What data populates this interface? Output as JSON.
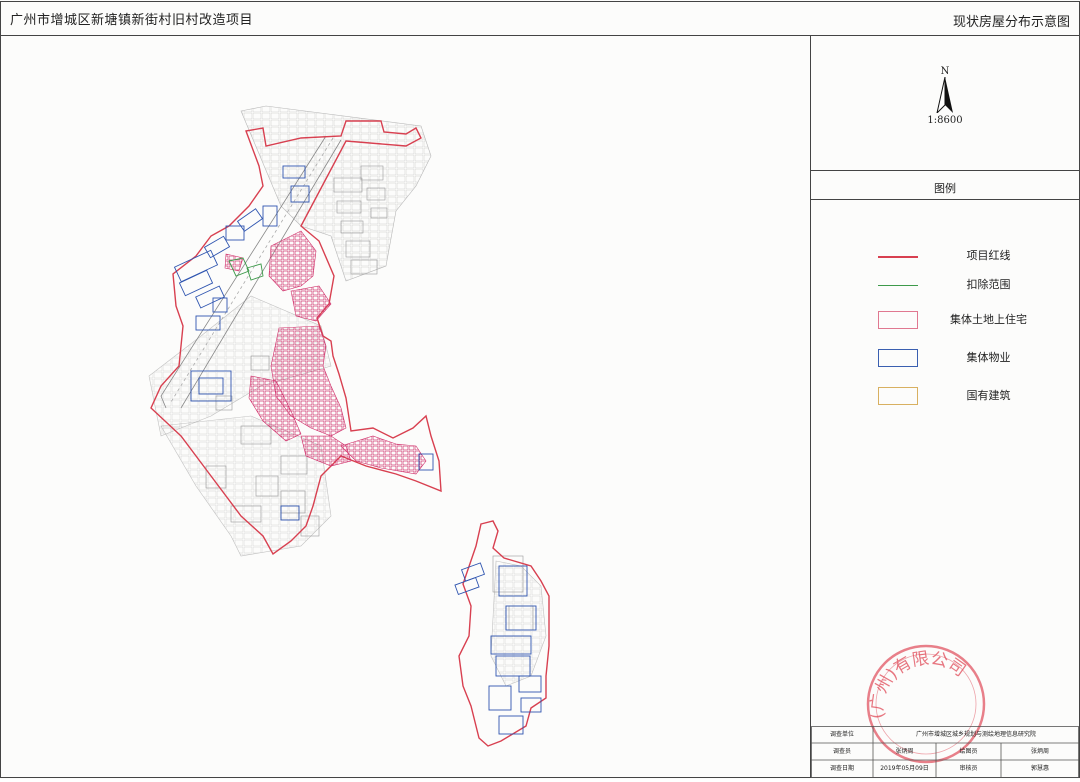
{
  "header": {
    "project_title": "广州市增城区新塘镇新街村旧村改造项目",
    "map_title": "现状房屋分布示意图"
  },
  "north_arrow": {
    "label": "N",
    "scale": "1:8600"
  },
  "legend": {
    "title": "图例",
    "items": [
      {
        "label": "项目红线",
        "symbol": "line",
        "color": "#d84050"
      },
      {
        "label": "扣除范围",
        "symbol": "line",
        "color": "#3d9a4a"
      },
      {
        "label": "集体土地上住宅",
        "symbol": "box",
        "color": "#e07890"
      },
      {
        "label": "集体物业",
        "symbol": "box",
        "color": "#3a5fb0"
      },
      {
        "label": "国有建筑",
        "symbol": "box",
        "color": "#d8b060"
      }
    ]
  },
  "info_table": {
    "row1": {
      "k1": "调查单位",
      "v1": "广州市增城区城乡规划与测绘地理信息研究院"
    },
    "row2": {
      "k1": "调查员",
      "v1": "张炳周",
      "k2": "绘图员",
      "v2": "张炳周"
    },
    "row3": {
      "k1": "调查日期",
      "v1": "2019年05月09日",
      "k2": "审核员",
      "v2": "郭慧惠"
    }
  },
  "stamp": {
    "text": "(广州)有限公司"
  },
  "colors": {
    "red_line": "#d84050",
    "residential": "#d0306a",
    "collective": "#2f55b0",
    "building_gray": "#9a9a9a"
  }
}
